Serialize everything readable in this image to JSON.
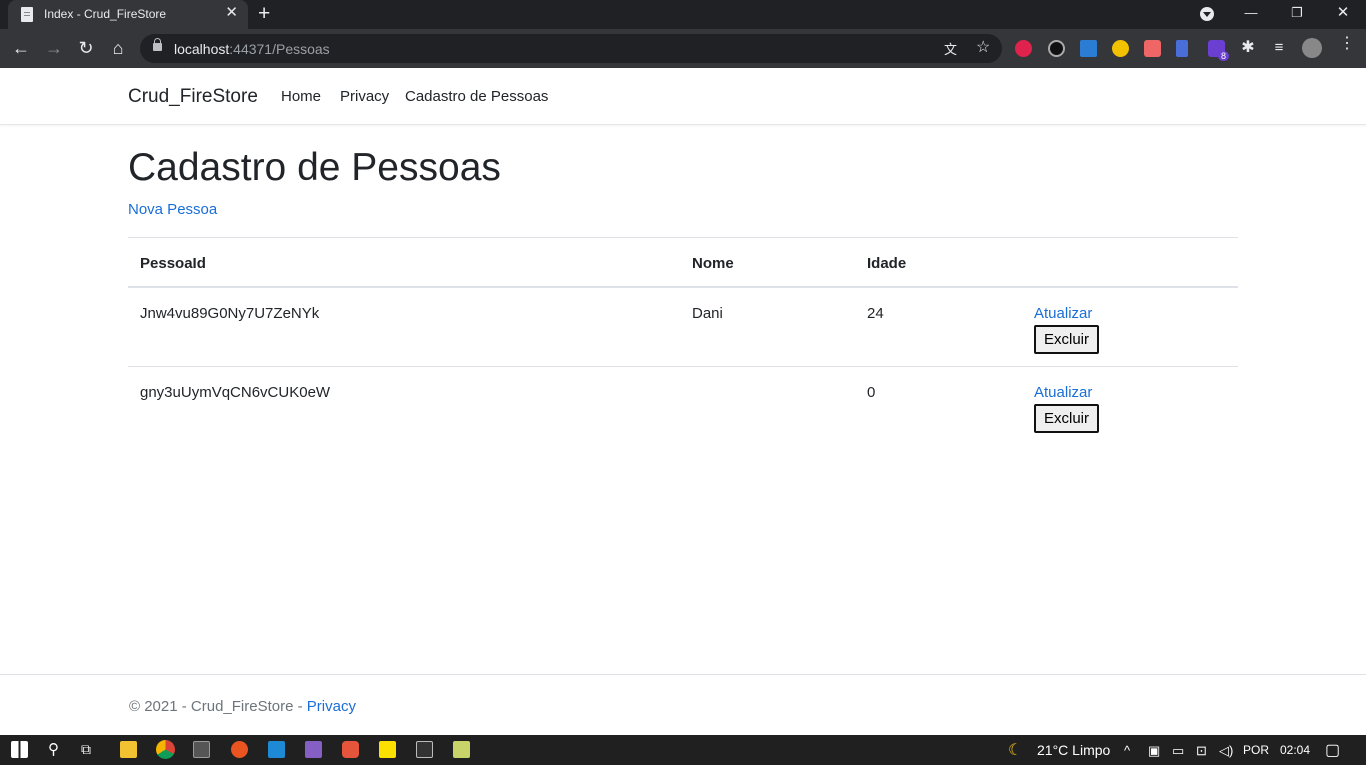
{
  "browser": {
    "tab_title": "Index - Crud_FireStore",
    "url_host": "localhost",
    "url_path": ":44371/Pessoas",
    "extension_badge": "8"
  },
  "navbar": {
    "brand": "Crud_FireStore",
    "links": [
      "Home",
      "Privacy",
      "Cadastro de Pessoas"
    ]
  },
  "main": {
    "title": "Cadastro de Pessoas",
    "new_link": "Nova Pessoa",
    "columns": [
      "PessoaId",
      "Nome",
      "Idade"
    ],
    "rows": [
      {
        "id": "Jnw4vu89G0Ny7U7ZeNYk",
        "nome": "Dani",
        "idade": "24",
        "update": "Atualizar",
        "delete": "Excluir"
      },
      {
        "id": "gny3uUymVqCN6vCUK0eW",
        "nome": "",
        "idade": "0",
        "update": "Atualizar",
        "delete": "Excluir"
      }
    ]
  },
  "footer": {
    "text": "© 2021 - Crud_FireStore - ",
    "link": "Privacy"
  },
  "taskbar": {
    "weather": "21°C  Limpo",
    "lang": "POR",
    "time": "02:04"
  }
}
